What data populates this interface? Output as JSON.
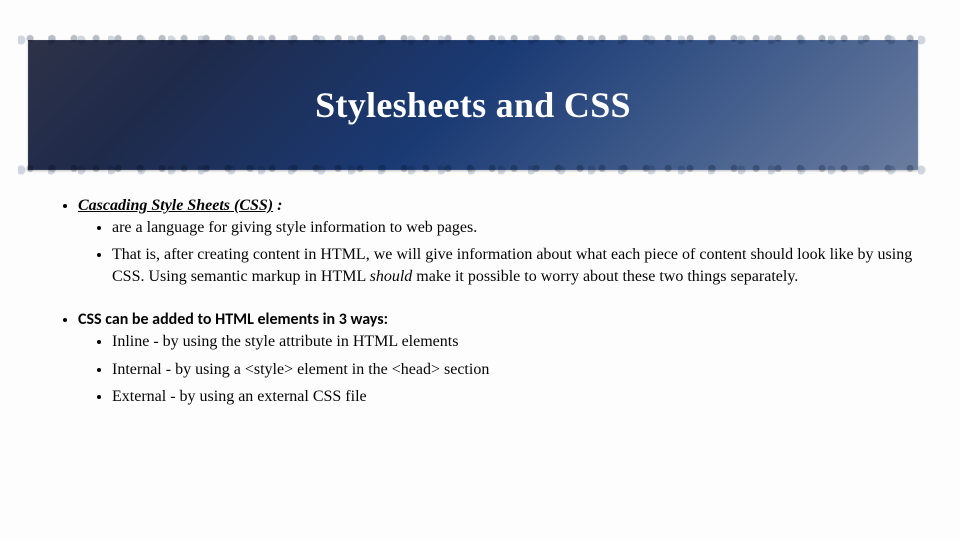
{
  "title": "Stylesheets and CSS",
  "section1": {
    "lead_bold_u": "Cascading Style Sheets (CSS)",
    "lead_tail": " :",
    "items": [
      "are a language for giving style information to web pages.",
      {
        "pre": "That is, after creating content in HTML, we will give information about what each piece of content should look like by using CSS. Using semantic markup in HTML ",
        "em": "should",
        "post": " make it possible to worry about these two things separately."
      }
    ]
  },
  "section2": {
    "lead": "CSS can be added to HTML elements in 3 ways:",
    "items": [
      "Inline - by using the style attribute in HTML elements",
      "Internal - by using a <style> element in the <head> section",
      "External - by using an external CSS file"
    ]
  }
}
